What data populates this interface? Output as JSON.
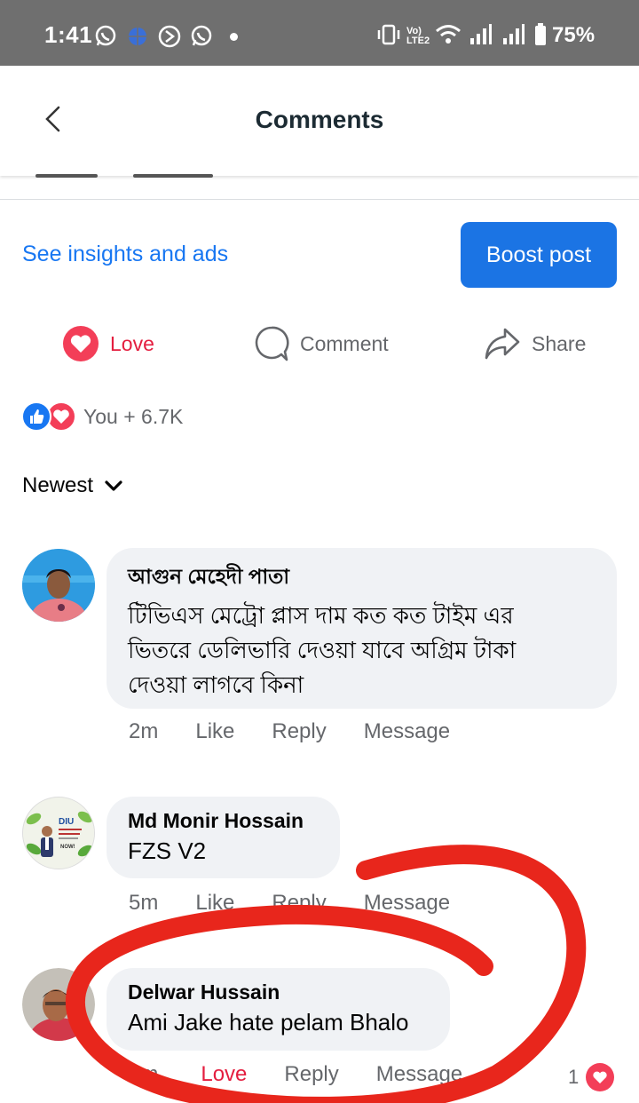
{
  "status_bar": {
    "time": "1:41",
    "network_label": "Vo) LTE2",
    "battery": "75%",
    "icons": [
      "whatsapp-icon",
      "vpn-icon",
      "play-icon",
      "whatsapp-icon",
      "notification-dot",
      "vibrate-icon",
      "wifi-icon",
      "signal-icon",
      "signal-icon",
      "battery-icon"
    ]
  },
  "header": {
    "title": "Comments",
    "back_icon": "chevron-left-icon"
  },
  "insights": {
    "link": "See insights and ads",
    "boost_label": "Boost post"
  },
  "actions": {
    "love": "Love",
    "comment": "Comment",
    "share": "Share"
  },
  "reactions": {
    "summary": "You + 6.7K"
  },
  "sort": {
    "label": "Newest"
  },
  "comments": [
    {
      "name": "আগুন মেহেদী পাতা",
      "text_lines": [
        "টিভিএস মেট্রো প্লাস দাম কত কত টাইম এর",
        "ভিতরে ডেলিভারি দেওয়া যাবে অগ্রিম টাকা",
        "দেওয়া লাগবে কিনা"
      ],
      "time": "2m",
      "like": "Like",
      "reply": "Reply",
      "message": "Message"
    },
    {
      "name": "Md Monir Hossain",
      "text": "FZS V2",
      "time": "5m",
      "like": "Like",
      "reply": "Reply",
      "message": "Message",
      "avatar_text": [
        "DIU",
        "NOW!"
      ]
    },
    {
      "name": "Delwar Hussain",
      "text": "Ami Jake hate pelam Bhalo",
      "time": "9m",
      "like": "Love",
      "reply": "Reply",
      "message": "Message",
      "reaction_count": "1"
    }
  ],
  "colors": {
    "accent": "#1877f2",
    "love": "#e41e3f",
    "annotation": "#e8261c",
    "status_bar": "#6f6f6f"
  }
}
